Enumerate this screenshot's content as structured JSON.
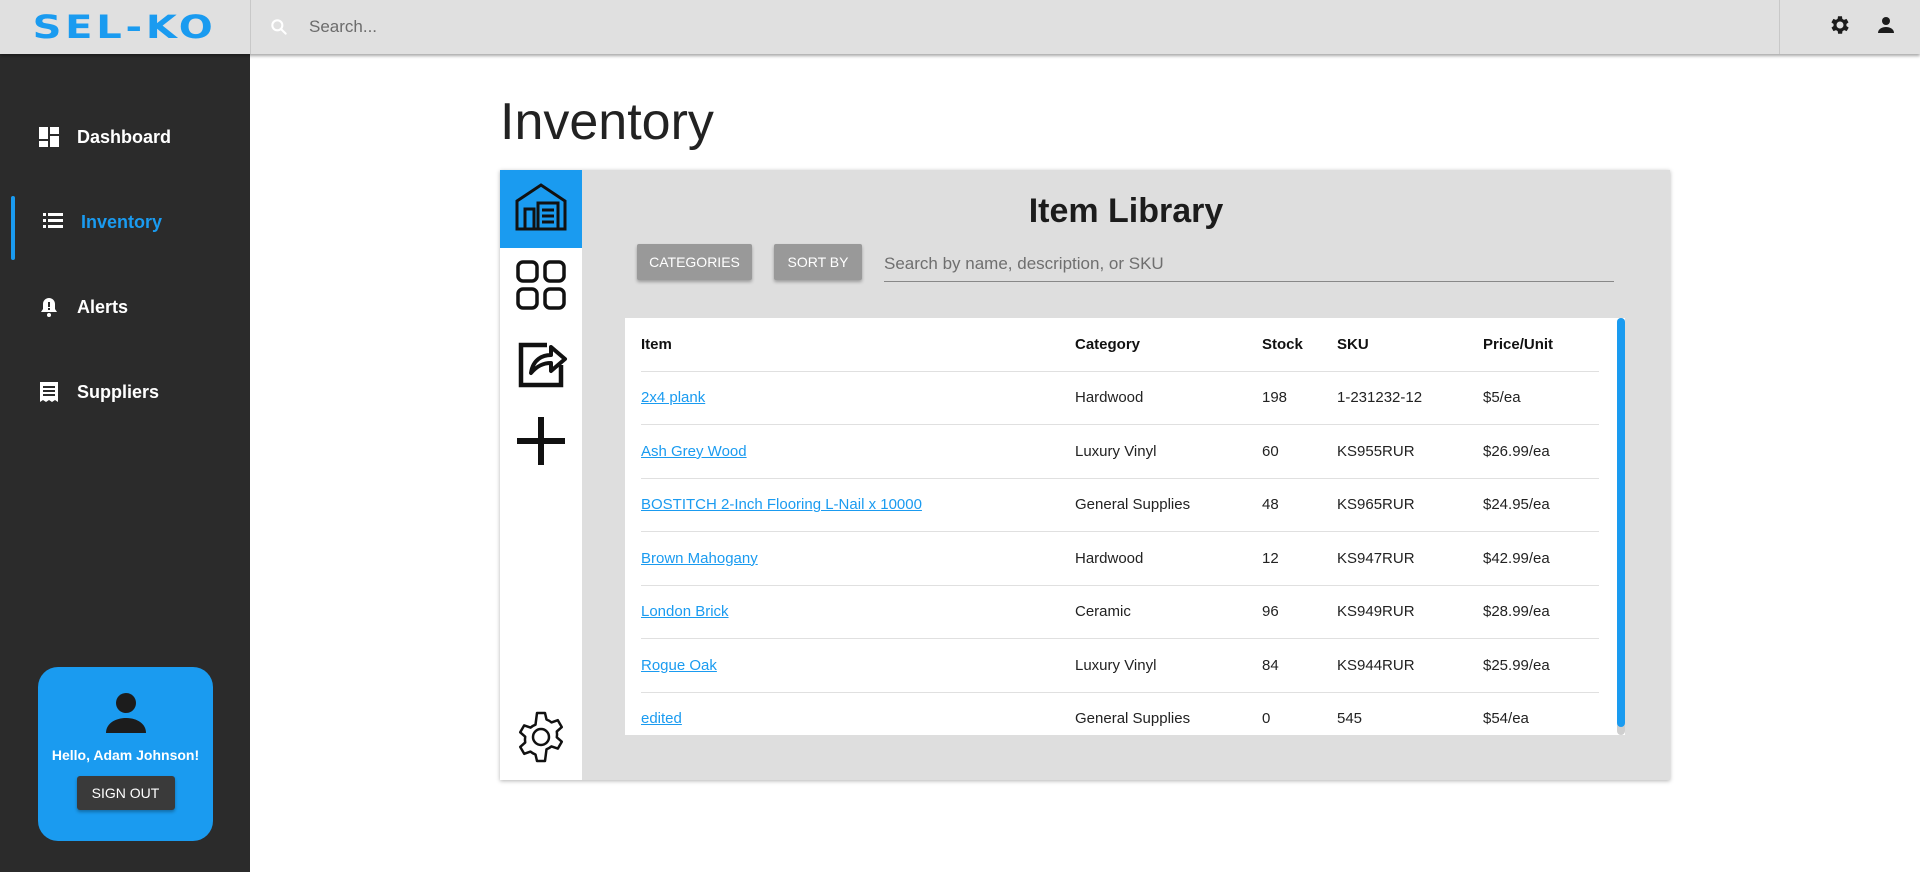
{
  "app": {
    "logo": "SEL-KO",
    "search_placeholder": "Search...",
    "brand_color": "#1a9bf0"
  },
  "sidebar": {
    "items": [
      {
        "label": "Dashboard",
        "icon": "dashboard-icon",
        "active": false
      },
      {
        "label": "Inventory",
        "icon": "list-icon",
        "active": true
      },
      {
        "label": "Alerts",
        "icon": "bell-icon",
        "active": false
      },
      {
        "label": "Suppliers",
        "icon": "receipt-icon",
        "active": false
      }
    ],
    "user": {
      "greeting": "Hello, Adam Johnson!",
      "sign_out_label": "SIGN OUT"
    }
  },
  "main": {
    "page_title": "Inventory",
    "library": {
      "title": "Item Library",
      "categories_label": "CATEGORIES",
      "sort_by_label": "SORT BY",
      "search_placeholder": "Search by name, description, or SKU",
      "rail_icons": [
        "warehouse-icon",
        "grid-icon",
        "share-icon",
        "plus-icon",
        "settings-gear-icon"
      ],
      "table": {
        "headers": [
          "Item",
          "Category",
          "Stock",
          "SKU",
          "Price/Unit"
        ],
        "rows": [
          [
            "2x4 plank",
            "Hardwood",
            "198",
            "1-231232-12",
            "$5/ea"
          ],
          [
            "Ash Grey Wood",
            "Luxury Vinyl",
            "60",
            "KS955RUR",
            "$26.99/ea"
          ],
          [
            "BOSTITCH 2-Inch Flooring L-Nail x 10000",
            "General Supplies",
            "48",
            "KS965RUR",
            "$24.95/ea"
          ],
          [
            "Brown Mahogany",
            "Hardwood",
            "12",
            "KS947RUR",
            "$42.99/ea"
          ],
          [
            "London Brick",
            "Ceramic",
            "96",
            "KS949RUR",
            "$28.99/ea"
          ],
          [
            "Rogue Oak",
            "Luxury Vinyl",
            "84",
            "KS944RUR",
            "$25.99/ea"
          ],
          [
            "edited",
            "General Supplies",
            "0",
            "545",
            "$54/ea"
          ]
        ]
      }
    }
  }
}
